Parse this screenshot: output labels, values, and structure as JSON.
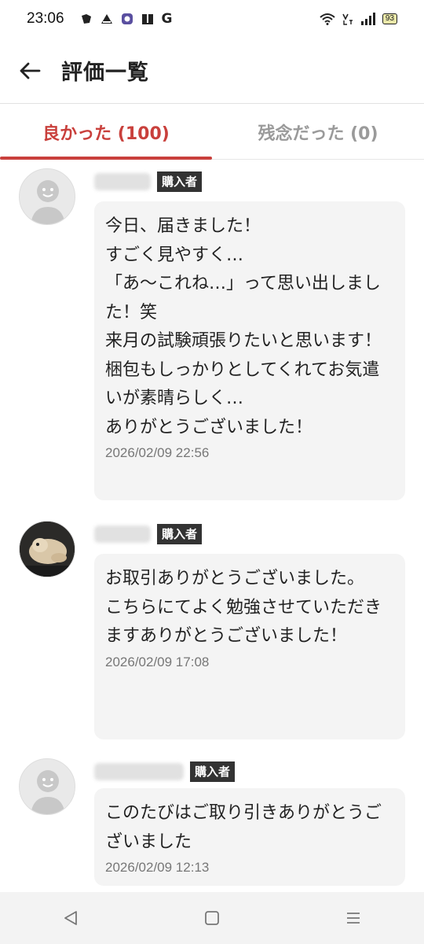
{
  "status_bar": {
    "time": "23:06",
    "app_letter": "G",
    "battery": "93",
    "icons": [
      "wifi-icon",
      "volte-icon",
      "signal-icon",
      "battery-icon"
    ]
  },
  "header": {
    "title": "評価一覧"
  },
  "tabs": [
    {
      "label": "良かった (100)",
      "active": true
    },
    {
      "label": "残念だった (0)",
      "active": false
    }
  ],
  "accent_color": "#c9403c",
  "reviews": [
    {
      "badge": "購入者",
      "comment": "今日、届きました！\nすごく見やすく…\n「あ〜これね…」って思い出しました！笑\n来月の試験頑張りたいと思います！\n梱包もしっかりとしてくれてお気遣いが素晴らしく…\nありがとうございました！",
      "date": "2026/02/09 22:56",
      "avatar": "default-avatar"
    },
    {
      "badge": "購入者",
      "comment": "お取引ありがとうございました。\nこちらにてよく勉強させていただきますありがとうございました！",
      "date": "2026/02/09 17:08",
      "avatar": "dog-photo-avatar"
    },
    {
      "badge": "購入者",
      "comment": "このたびはご取り引きありがとうございました",
      "date": "2026/02/09 12:13",
      "avatar": "default-avatar"
    }
  ]
}
